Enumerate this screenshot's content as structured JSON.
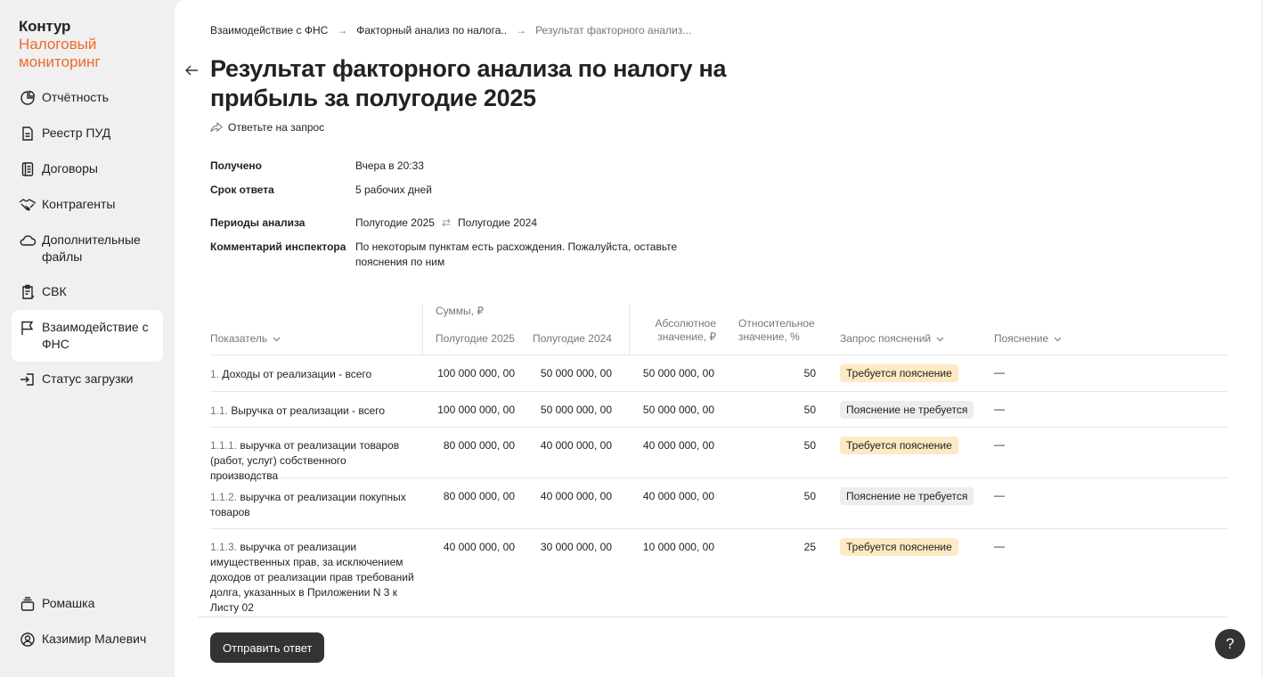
{
  "brand": {
    "line1": "Контур",
    "line2": "Налоговый",
    "line3": "мониторинг"
  },
  "sidebar": {
    "items": [
      {
        "label": "Отчётность",
        "icon": "pie-chart-icon"
      },
      {
        "label": "Реестр ПУД",
        "icon": "document-icon"
      },
      {
        "label": "Договоры",
        "icon": "notebook-icon"
      },
      {
        "label": "Контрагенты",
        "icon": "handshake-icon"
      },
      {
        "label": "Дополнительные файлы",
        "icon": "cloud-icon"
      },
      {
        "label": "СВК",
        "icon": "clipboard-icon"
      },
      {
        "label": "Взаимодействие с ФНС",
        "icon": "flag-icon",
        "active": true
      },
      {
        "label": "Статус загрузки",
        "icon": "sign-in-icon"
      }
    ],
    "org": "Ромашка",
    "user": "Казимир Малевич"
  },
  "breadcrumb": {
    "items": [
      "Взаимодействие с ФНС",
      "Факторный анализ по налога..",
      "Результат факторного анализ..."
    ]
  },
  "page": {
    "title": "Результат факторного анализа по налогу на прибыль за полугодие 2025",
    "reply_link": "Ответьте на запрос"
  },
  "meta": {
    "received_label": "Получено",
    "received_value": "Вчера в 20:33",
    "deadline_label": "Срок ответа",
    "deadline_value": "5 рабочих дней",
    "periods_label": "Периоды анализа",
    "period_a": "Полугодие 2025",
    "period_b": "Полугодие 2024",
    "comment_label": "Комментарий инспектора",
    "comment_value": "По некоторым пунктам есть расхождения. Пожалуйста, оставьте пояснения по ним"
  },
  "table": {
    "headers": {
      "indicator": "Показатель",
      "sums_group": "Суммы, ₽",
      "h2025": "Полугодие 2025",
      "h2024": "Полугодие 2024",
      "abs": "Абсолютное значение, ₽",
      "rel": "Относительное значение, %",
      "request": "Запрос пояснений",
      "explanation": "Пояснение"
    },
    "rows": [
      {
        "num": "1.",
        "name": "Доходы от реализации - всего",
        "v2025": "100 000 000, 00",
        "v2024": "50 000 000, 00",
        "abs": "50 000 000, 00",
        "rel": "50",
        "status": "Требуется пояснение",
        "status_type": "warn",
        "explanation": "—"
      },
      {
        "num": "1.1.",
        "name": "Выручка от реализации - всего",
        "v2025": "100 000 000, 00",
        "v2024": "50 000 000, 00",
        "abs": "50 000 000, 00",
        "rel": "50",
        "status": "Пояснение не требуется",
        "status_type": "ok",
        "explanation": "—"
      },
      {
        "num": "1.1.1.",
        "name": "выручка от реализации товаров (работ, услуг) собственного производства",
        "v2025": "80 000 000, 00",
        "v2024": "40 000 000, 00",
        "abs": "40 000 000, 00",
        "rel": "50",
        "status": "Требуется пояснение",
        "status_type": "warn",
        "explanation": "—"
      },
      {
        "num": "1.1.2.",
        "name": "выручка от реализации покупных товаров",
        "v2025": "80 000 000, 00",
        "v2024": "40 000 000, 00",
        "abs": "40 000 000, 00",
        "rel": "50",
        "status": "Пояснение не требуется",
        "status_type": "ok",
        "explanation": "—"
      },
      {
        "num": "1.1.3.",
        "name": "выручка от реализации имущественных прав, за исключением доходов от реализации прав требований долга, указанных в Приложении N 3 к Листу 02",
        "v2025": "40 000 000, 00",
        "v2024": "30 000 000, 00",
        "abs": "10 000 000, 00",
        "rel": "25",
        "status": "Требуется пояснение",
        "status_type": "warn",
        "explanation": "—"
      }
    ]
  },
  "actions": {
    "send": "Отправить ответ",
    "help": "?"
  },
  "colors": {
    "brand_accent": "#ee6a2a",
    "warn_badge": "#fdeac4",
    "ok_badge": "#ededed",
    "button_dark": "#333333"
  }
}
